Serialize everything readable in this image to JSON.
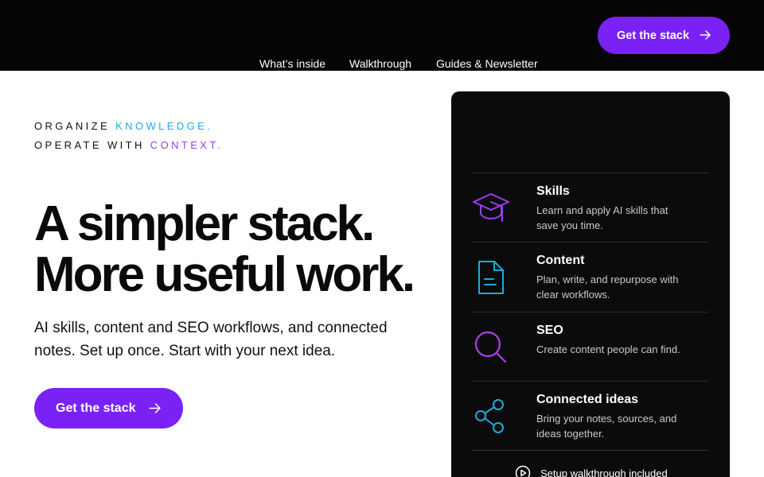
{
  "nav": {
    "items": [
      "What’s inside",
      "Walkthrough",
      "Guides & Newsletter"
    ],
    "cta_label": "Get the stack"
  },
  "hero": {
    "eyebrow_line1_prefix": "ORGANIZE ",
    "eyebrow_line1_accent": "KNOWLEDGE.",
    "eyebrow_line2_prefix": "OPERATE WITH ",
    "eyebrow_line2_accent": "CONTEXT.",
    "headline_line1": "A simpler stack.",
    "headline_line2": "More useful work.",
    "subhead": "AI skills, content and SEO workflows, and connected notes. Set up once. Start with your next idea.",
    "cta_label": "Get the stack"
  },
  "card": {
    "features": [
      {
        "icon": "graduation-cap-icon",
        "title": "Skills",
        "description": "Learn and apply AI skills that save you time."
      },
      {
        "icon": "document-icon",
        "title": "Content",
        "description": "Plan, write, and repurpose with clear workflows."
      },
      {
        "icon": "search-icon",
        "title": "SEO",
        "description": "Create content people can find."
      },
      {
        "icon": "share-nodes-icon",
        "title": "Connected ideas",
        "description": "Bring your notes, sources, and ideas together."
      }
    ],
    "footer_text": "Setup walkthrough included"
  },
  "colors": {
    "brand_purple": "#7a22f5",
    "accent_cyan": "#22a9d8",
    "accent_purple": "#9b3df0",
    "header_bg": "#050505",
    "card_bg": "#0b0b0c"
  }
}
